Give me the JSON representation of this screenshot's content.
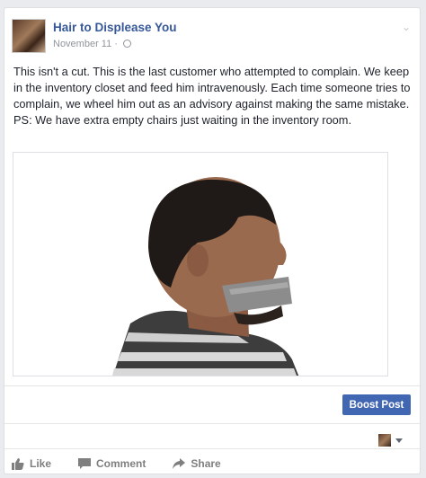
{
  "post": {
    "page_name": "Hair to Displease You",
    "date": "November 11 · ",
    "text": "This isn't a cut. This is the last customer who attempted to complain. We keep in the inventory closet and feed him intravenously. Each time someone tries to complain, we wheel him out as an advisory against making the same mistake. PS: We have extra empty chairs just waiting in the inventory room.",
    "privacy_icon": "globe-icon",
    "media_description_icon": "photo"
  },
  "toolbar": {
    "boost_label": "Boost Post"
  },
  "actions": {
    "like": "Like",
    "comment": "Comment",
    "share": "Share"
  },
  "colors": {
    "link": "#365899",
    "button": "#4267b2",
    "muted": "#90949c"
  }
}
